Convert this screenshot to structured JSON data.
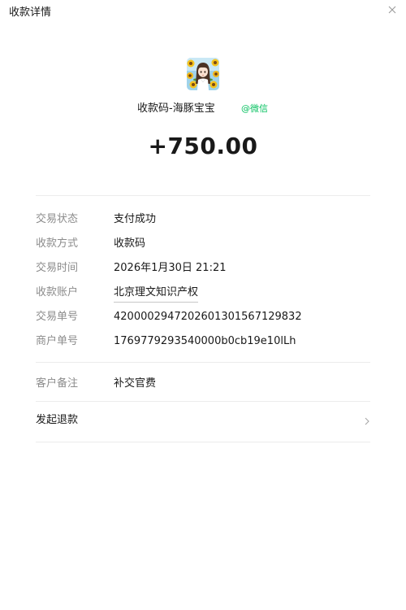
{
  "window": {
    "title": "收款详情"
  },
  "payee": {
    "name": "收款码-海豚宝宝",
    "platform_tag": "@微信"
  },
  "amount": "+750.00",
  "details": [
    {
      "label": "交易状态",
      "value": "支付成功"
    },
    {
      "label": "收款方式",
      "value": "收款码"
    },
    {
      "label": "交易时间",
      "value": "2026年1月30日 21:21"
    },
    {
      "label": "收款账户",
      "value": "北京理文知识产权"
    },
    {
      "label": "交易单号",
      "value": "4200002947202601301567129832"
    },
    {
      "label": "商户单号",
      "value": "1769779293540000b0cb19e10lLh"
    }
  ],
  "remark": {
    "label": "客户备注",
    "value": "补交官费"
  },
  "refund": {
    "label": "发起退款"
  },
  "icons": {
    "close": "close-icon",
    "chevron": "chevron-right-icon",
    "avatar": "sunflower-girl-avatar"
  },
  "colors": {
    "accent_green": "#07c160",
    "label_gray": "#8c8c8c",
    "text": "#191919"
  }
}
